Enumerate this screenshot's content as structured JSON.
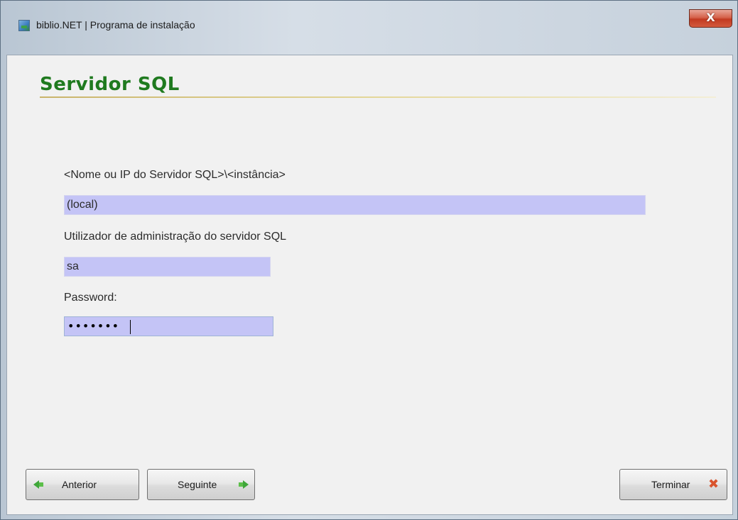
{
  "window": {
    "title": "biblio.NET | Programa de instalação",
    "close_label": "X"
  },
  "page": {
    "title": "Servidor SQL"
  },
  "form": {
    "server": {
      "label": "<Nome ou IP do Servidor SQL>\\<instância>",
      "value": "(local)"
    },
    "admin_user": {
      "label": "Utilizador de administração do servidor SQL",
      "value": "sa"
    },
    "password": {
      "label": "Password:",
      "masked_value": "•••••••"
    }
  },
  "buttons": {
    "previous_label": "Anterior",
    "next_label": "Seguinte",
    "finish_label": "Terminar"
  },
  "icons": {
    "previous": "arrow-left-icon",
    "next": "arrow-right-icon",
    "finish": "close-x-icon"
  },
  "colors": {
    "title_green": "#1f7a1f",
    "input_background": "#c4c4f6",
    "close_red": "#c23a21"
  }
}
